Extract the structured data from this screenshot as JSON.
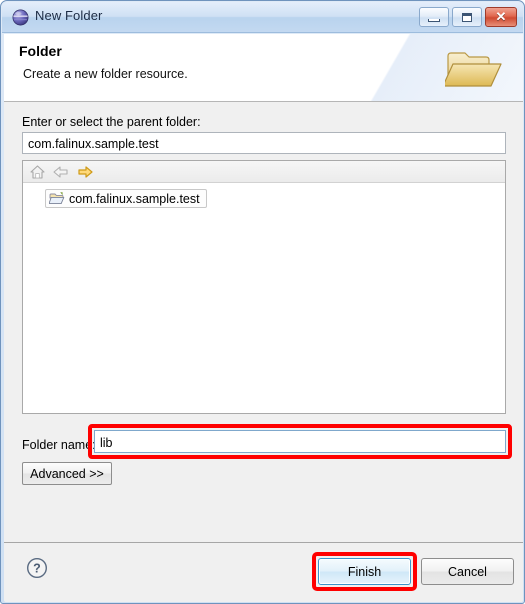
{
  "window": {
    "title": "New Folder",
    "app_icon": "eclipse-sphere-icon",
    "controls": {
      "minimize": "minimize-icon",
      "maximize": "maximize-icon",
      "close_glyph": "✕"
    }
  },
  "header": {
    "title": "Folder",
    "description": "Create a new folder resource.",
    "icon": "open-folder-icon"
  },
  "body": {
    "parent_label": "Enter or select the parent folder:",
    "parent_value": "com.falinux.sample.test",
    "parent_placeholder": "",
    "tree_toolbar": [
      {
        "name": "home-icon",
        "enabled": false
      },
      {
        "name": "back-arrow-icon",
        "enabled": false
      },
      {
        "name": "forward-arrow-icon",
        "enabled": true
      }
    ],
    "tree_items": [
      {
        "label": "com.falinux.sample.test",
        "icon": "open-folder-small-icon",
        "selected": true
      }
    ],
    "foldername_label": "Folder name:",
    "foldername_value": "lib",
    "foldername_placeholder": "",
    "advanced_label": "Advanced >>"
  },
  "footer": {
    "help_icon": "help-question-icon",
    "finish_label": "Finish",
    "cancel_label": "Cancel"
  },
  "annotations": {
    "color": "#ff0000",
    "targets": [
      "folder-name-input",
      "finish-button"
    ]
  },
  "colors": {
    "titlebar_top": "#e4eefb",
    "titlebar_bottom": "#c3d9f1",
    "window_border": "#6f93bd",
    "body_background": "#f0f0f0",
    "close_button": "#cf4a31",
    "focus_blue": "#3c93c9",
    "folder_icon": "#e2bf6a"
  }
}
